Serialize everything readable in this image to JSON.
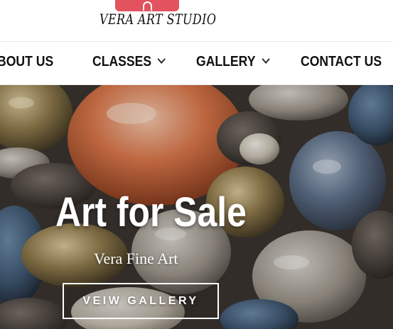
{
  "brand": {
    "logo_text": "VERA ART STUDIO",
    "badge_color": "#e2525f"
  },
  "nav": {
    "items": [
      {
        "label": "BOUT US",
        "has_dropdown": false
      },
      {
        "label": "CLASSES",
        "has_dropdown": true
      },
      {
        "label": "GALLERY",
        "has_dropdown": true
      },
      {
        "label": "CONTACT US",
        "has_dropdown": false
      }
    ]
  },
  "hero": {
    "title": "Art for Sale",
    "subtitle": "Vera Fine Art",
    "button_label": "VEIW GALLERY",
    "background": "painting of river stones"
  }
}
